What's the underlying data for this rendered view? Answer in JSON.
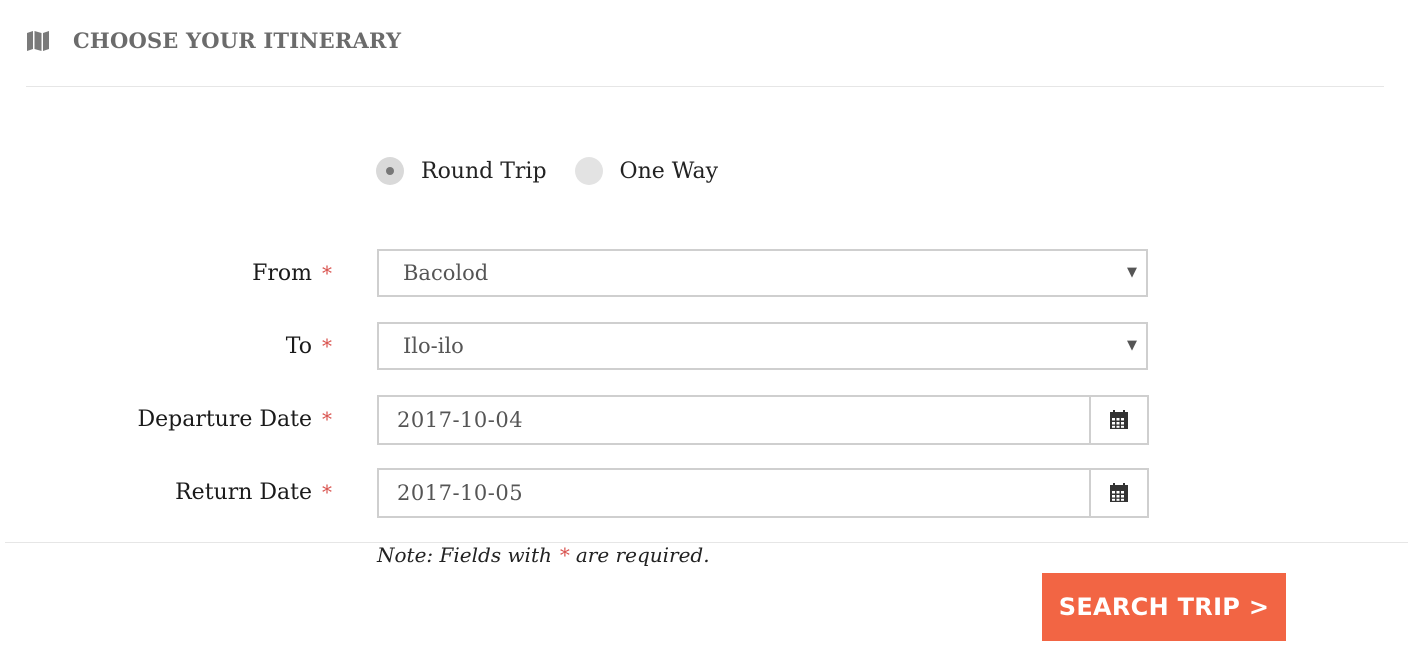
{
  "header": {
    "title": "CHOOSE YOUR ITINERARY",
    "icon": "map-icon"
  },
  "trip_type": {
    "options": [
      {
        "label": "Round Trip",
        "selected": true
      },
      {
        "label": "One Way",
        "selected": false
      }
    ]
  },
  "form": {
    "required_marker": "*",
    "from": {
      "label": "From",
      "value": "Bacolod"
    },
    "to": {
      "label": "To",
      "value": "Ilo-ilo"
    },
    "departure": {
      "label": "Departure Date",
      "value": "2017-10-04"
    },
    "return": {
      "label": "Return Date",
      "value": "2017-10-05"
    }
  },
  "note": {
    "prefix": "Note: Fields with",
    "suffix": "are required."
  },
  "search_button": {
    "label": "SEARCH TRIP >"
  },
  "colors": {
    "accent": "#f26544",
    "required": "#d9534f",
    "header_text": "#6b6b6b"
  }
}
